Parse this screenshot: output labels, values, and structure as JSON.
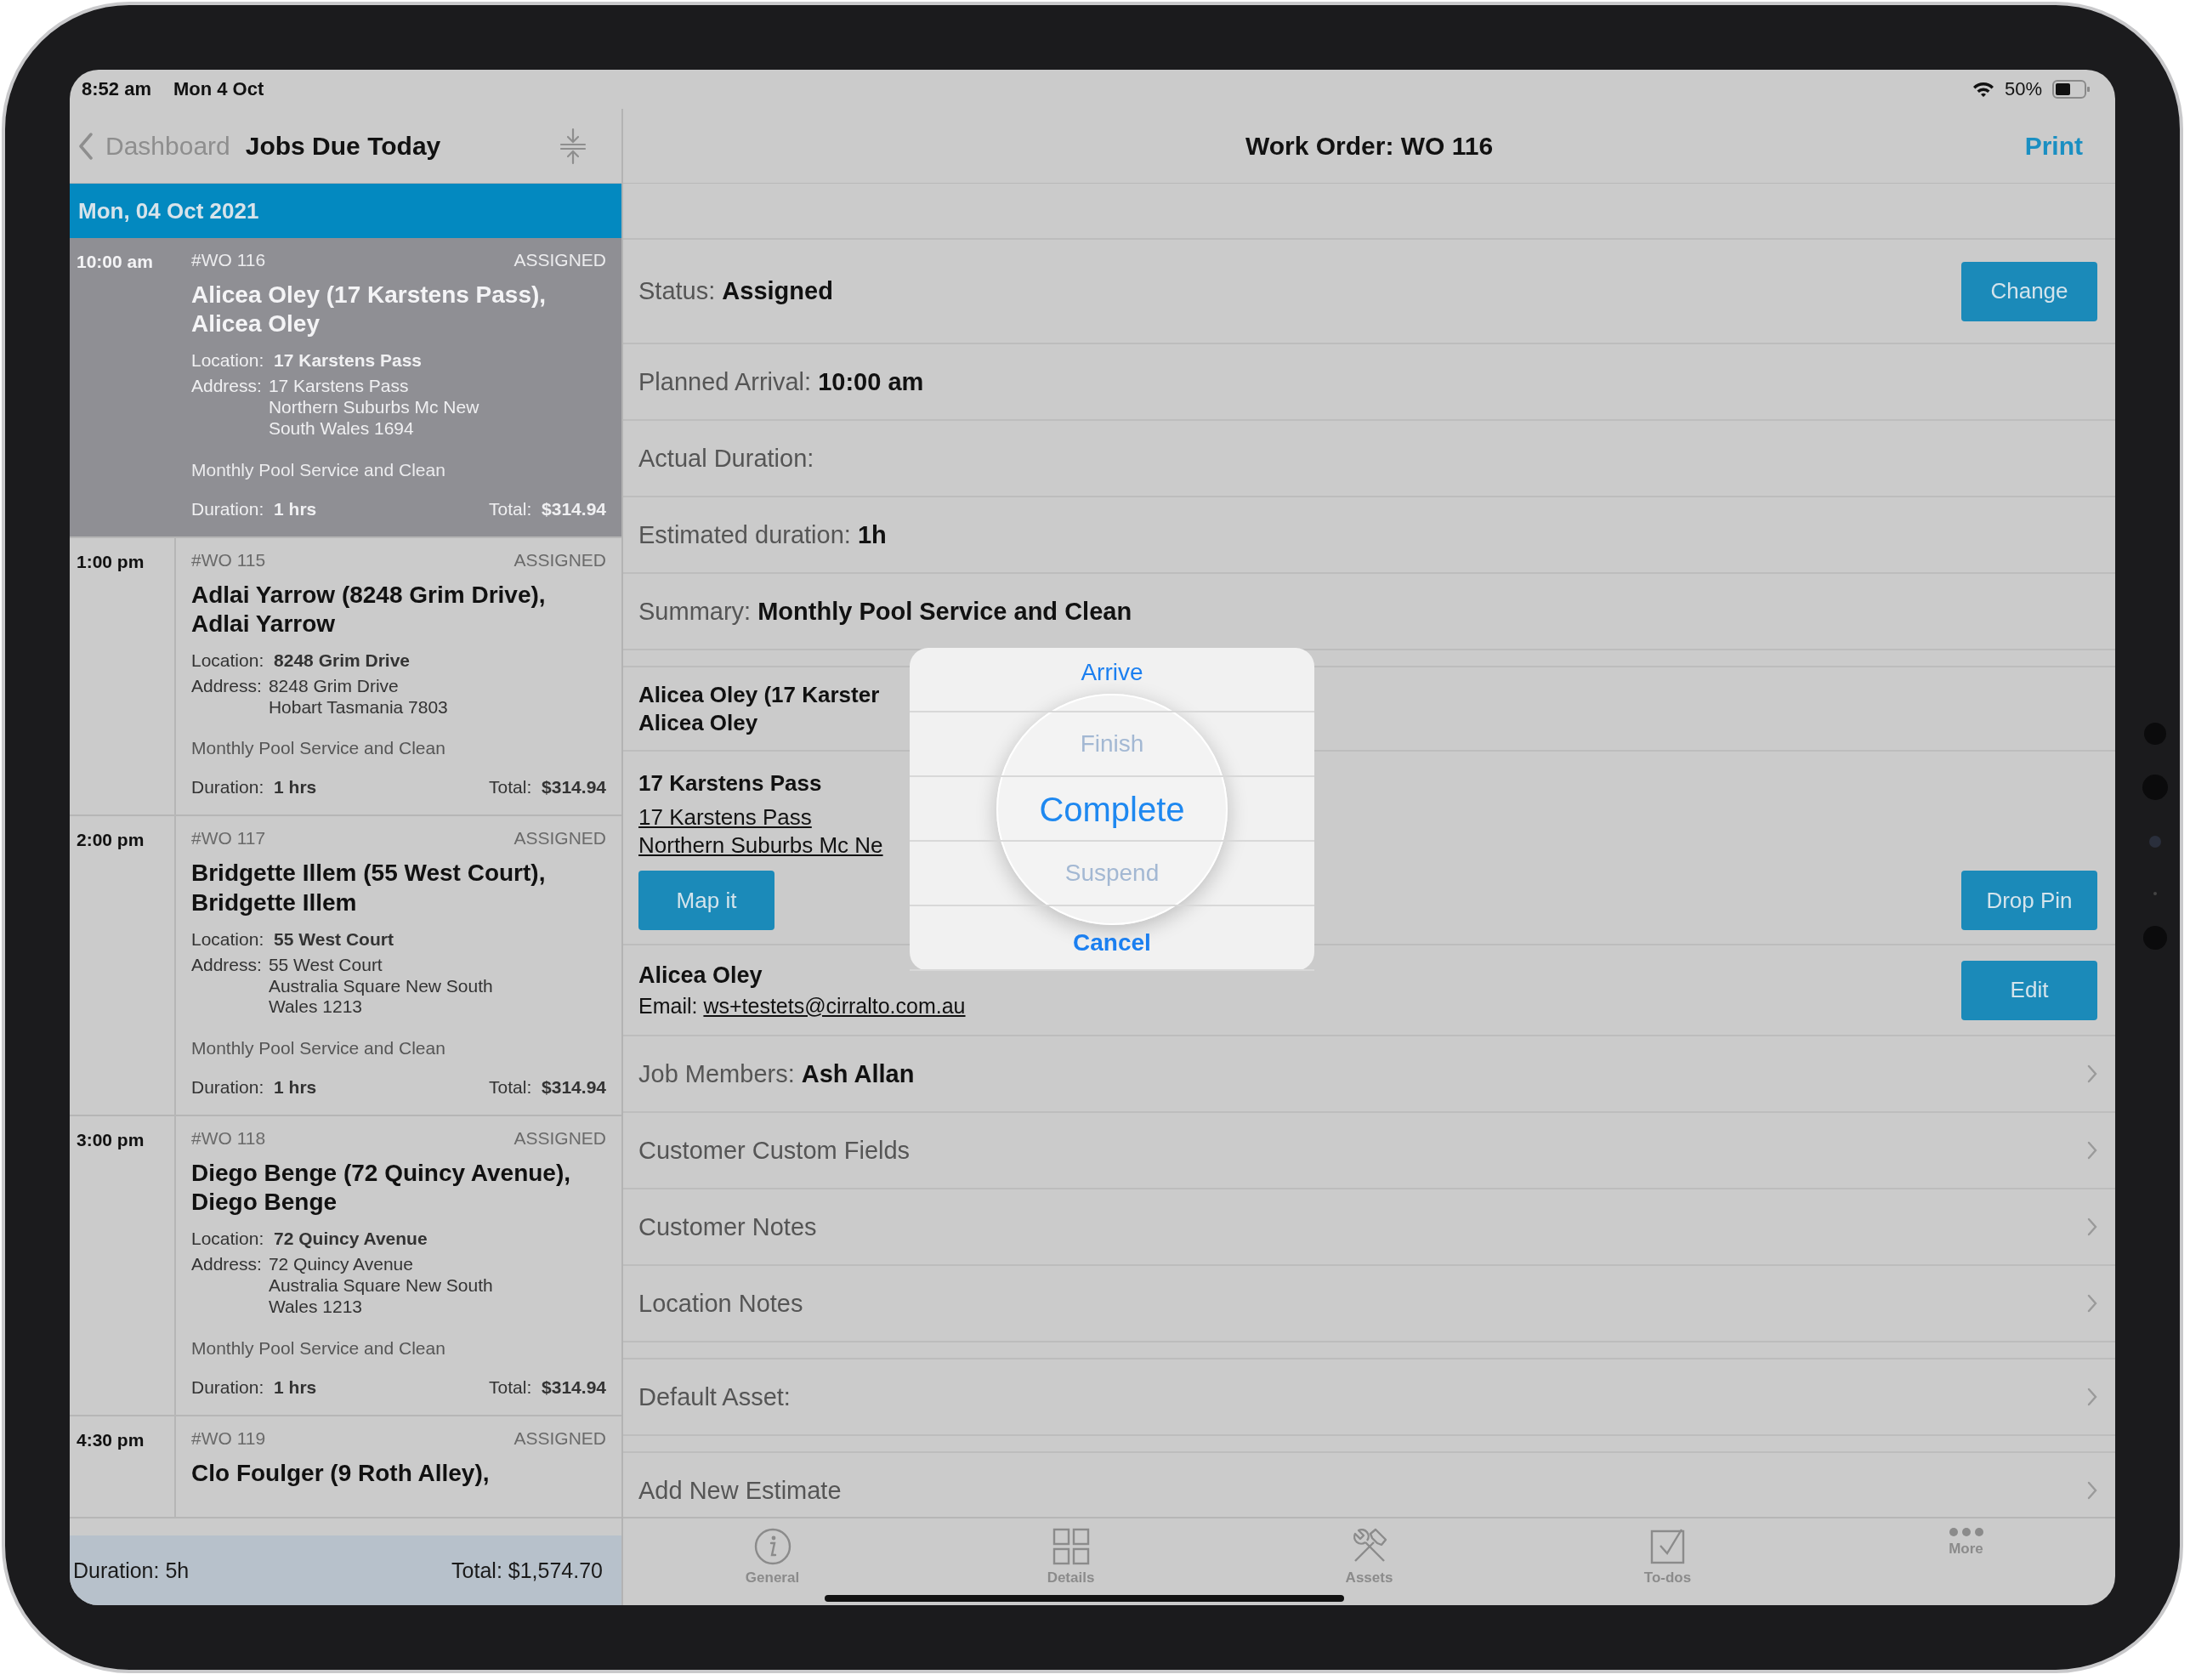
{
  "status_bar": {
    "time": "8:52 am",
    "date": "Mon 4 Oct",
    "battery": "50%"
  },
  "sidebar": {
    "back": "Dashboard",
    "title": "Jobs Due Today",
    "date_header": "Mon, 04 Oct 2021",
    "jobs": [
      {
        "time": "10:00 am",
        "number": "#WO 116",
        "status": "ASSIGNED",
        "title_lines": [
          "Alicea Oley (17 Karstens Pass),",
          "Alicea Oley"
        ],
        "location": "Location: **17 Karstens Pass**",
        "address_label": "Address:",
        "address": [
          "17 Karstens Pass",
          "Northern Suburbs Mc New",
          "South Wales 1694"
        ],
        "summary": "Monthly Pool Service and Clean",
        "duration": "Duration: **1 hrs**",
        "total": "Total: **$314.94**",
        "selected": true
      },
      {
        "time": "1:00 pm",
        "number": "#WO 115",
        "status": "ASSIGNED",
        "title_lines": [
          "Adlai Yarrow (8248 Grim Drive),",
          "Adlai Yarrow"
        ],
        "location": "Location: **8248 Grim Drive**",
        "address_label": "Address:",
        "address": [
          "8248 Grim Drive",
          "Hobart Tasmania 7803"
        ],
        "summary": "Monthly Pool Service and Clean",
        "duration": "Duration: **1 hrs**",
        "total": "Total: **$314.94**",
        "selected": false
      },
      {
        "time": "2:00 pm",
        "number": "#WO 117",
        "status": "ASSIGNED",
        "title_lines": [
          "Bridgette Illem (55 West Court),",
          "Bridgette Illem"
        ],
        "location": "Location: **55 West Court**",
        "address_label": "Address:",
        "address": [
          "55 West Court",
          "Australia Square New South",
          "Wales 1213"
        ],
        "summary": "Monthly Pool Service and Clean",
        "duration": "Duration: **1 hrs**",
        "total": "Total: **$314.94**",
        "selected": false
      },
      {
        "time": "3:00 pm",
        "number": "#WO 118",
        "status": "ASSIGNED",
        "title_lines": [
          "Diego Benge (72 Quincy Avenue),",
          "Diego Benge"
        ],
        "location": "Location: **72 Quincy Avenue**",
        "address_label": "Address:",
        "address": [
          "72 Quincy Avenue",
          "Australia Square New South",
          "Wales 1213"
        ],
        "summary": "Monthly Pool Service and Clean",
        "duration": "Duration: **1 hrs**",
        "total": "Total: **$314.94**",
        "selected": false
      },
      {
        "time": "4:30 pm",
        "number": "#WO 119",
        "status": "ASSIGNED",
        "title_lines": [
          "Clo Foulger (9 Roth Alley),"
        ],
        "selected": false
      }
    ],
    "footer": {
      "duration": "Duration: 5h",
      "total": "Total: $1,574.70"
    }
  },
  "detail": {
    "title": "Work Order: WO 116",
    "print": "Print",
    "sections": [
      [
        {
          "kind": "field",
          "text": "Status: **Assigned**",
          "button": "Change"
        },
        {
          "kind": "field",
          "text": "Planned Arrival: **10:00 am**"
        },
        {
          "kind": "field",
          "text": "Actual Duration:"
        },
        {
          "kind": "field",
          "text": "Estimated duration: **1h**"
        },
        {
          "kind": "field",
          "text": "Summary: **Monthly Pool Service and Clean**"
        }
      ],
      [
        {
          "kind": "customer",
          "lines": [
            "Alicea Oley (17 Karster",
            "Alicea Oley"
          ]
        },
        {
          "kind": "address",
          "heading": "17 Karstens Pass",
          "links": [
            "17 Karstens Pass",
            "Northern Suburbs Mc Ne"
          ],
          "button": "Map it",
          "button_right": "Drop Pin"
        },
        {
          "kind": "contact",
          "name": "Alicea Oley",
          "email_label": "Email:",
          "email": "ws+testets@cirralto.com.au",
          "button": "Edit"
        },
        {
          "kind": "link",
          "text": "Job Members: **Ash Allan**"
        },
        {
          "kind": "link",
          "text": "Customer Custom Fields"
        },
        {
          "kind": "link",
          "text": "Customer Notes"
        },
        {
          "kind": "link",
          "text": "Location Notes"
        }
      ],
      [
        {
          "kind": "link",
          "text": "Default Asset:"
        }
      ],
      [
        {
          "kind": "link",
          "text": "Add New Estimate"
        }
      ]
    ]
  },
  "action_sheet": {
    "actions": [
      {
        "label": "Arrive",
        "kind": "action",
        "disabled": false,
        "magnified": false
      },
      {
        "label": "Finish",
        "kind": "action",
        "disabled": true,
        "magnified": false
      },
      {
        "label": "Complete",
        "kind": "action",
        "disabled": false,
        "magnified": true
      },
      {
        "label": "Suspend",
        "kind": "action",
        "disabled": true,
        "magnified": false
      },
      {
        "label": "Cancel",
        "kind": "cancel",
        "disabled": false,
        "magnified": false
      }
    ]
  },
  "tab_bar": [
    {
      "label": "General",
      "selected": false
    },
    {
      "label": "Details",
      "selected": false
    },
    {
      "label": "Assets",
      "selected": false
    },
    {
      "label": "To-dos",
      "selected": false
    },
    {
      "label": "More",
      "selected": false
    }
  ]
}
